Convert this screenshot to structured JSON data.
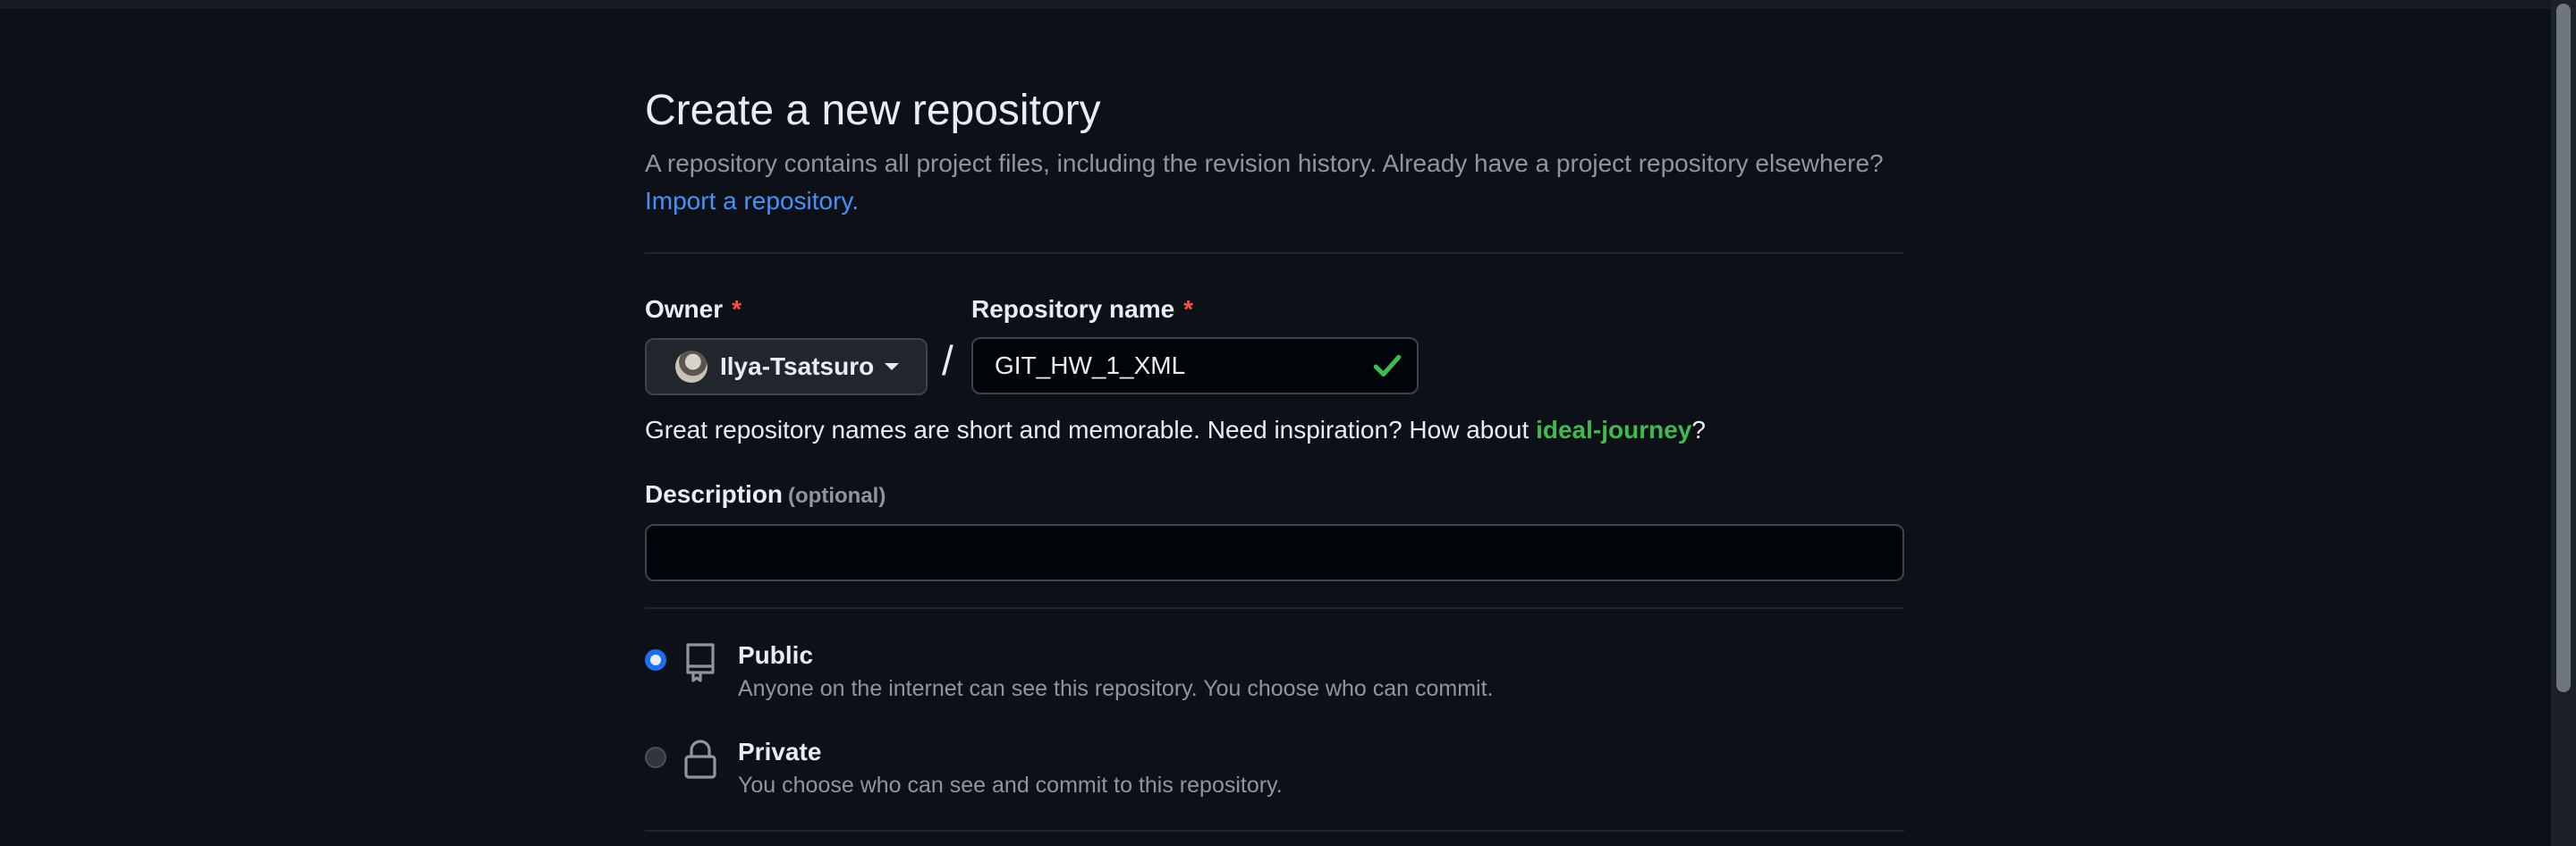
{
  "header": {
    "title": "Create a new repository",
    "description": "A repository contains all project files, including the revision history. Already have a project repository elsewhere?",
    "import_link": "Import a repository."
  },
  "owner": {
    "label": "Owner",
    "required_mark": "*",
    "selected": "Ilya-Tsatsuro"
  },
  "separator": "/",
  "repo_name": {
    "label": "Repository name",
    "required_mark": "*",
    "value": "GIT_HW_1_XML",
    "valid": true
  },
  "name_hint": {
    "text": "Great repository names are short and memorable. Need inspiration? How about",
    "suggestion": "ideal-journey",
    "suffix": "?"
  },
  "description_field": {
    "label": "Description",
    "optional": "(optional)",
    "value": ""
  },
  "visibility": {
    "options": [
      {
        "title": "Public",
        "description": "Anyone on the internet can see this repository. You choose who can commit.",
        "selected": true,
        "icon": "repo-icon"
      },
      {
        "title": "Private",
        "description": "You choose who can see and commit to this repository.",
        "selected": false,
        "icon": "lock-icon"
      }
    ]
  },
  "colors": {
    "background": "#0d1117",
    "link": "#4493f8",
    "success": "#3fb950",
    "required": "#f85149",
    "radio_selected": "#1f6feb"
  }
}
